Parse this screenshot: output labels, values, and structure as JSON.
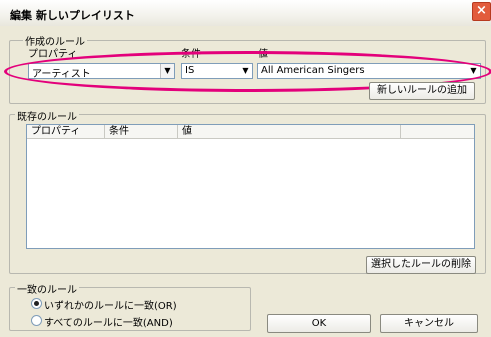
{
  "window": {
    "title": "編集 新しいプレイリスト",
    "close_glyph": "×"
  },
  "create_group": {
    "legend": "作成のルール",
    "property_label": "プロパティ",
    "condition_label": "条件",
    "value_label": "値",
    "property_value": "アーティスト",
    "condition_value": "IS",
    "value_value": "All American Singers",
    "add_button": "新しいルールの追加"
  },
  "existing_group": {
    "legend": "既存のルール",
    "columns": [
      "プロパティ",
      "条件",
      "値"
    ],
    "rows": [],
    "delete_button": "選択したルールの削除"
  },
  "match_group": {
    "legend": "一致のルール",
    "options": [
      "いずれかのルールに一致(OR)",
      "すべてのルールに一致(AND)"
    ],
    "selected_index": 0
  },
  "buttons": {
    "ok": "OK",
    "cancel": "キャンセル"
  },
  "colors": {
    "highlight": "#e3007b",
    "dialog_bg": "#ece9d8",
    "close_bg": "#e25c3c"
  },
  "icons": {
    "dropdown": "▼",
    "close": "×"
  }
}
